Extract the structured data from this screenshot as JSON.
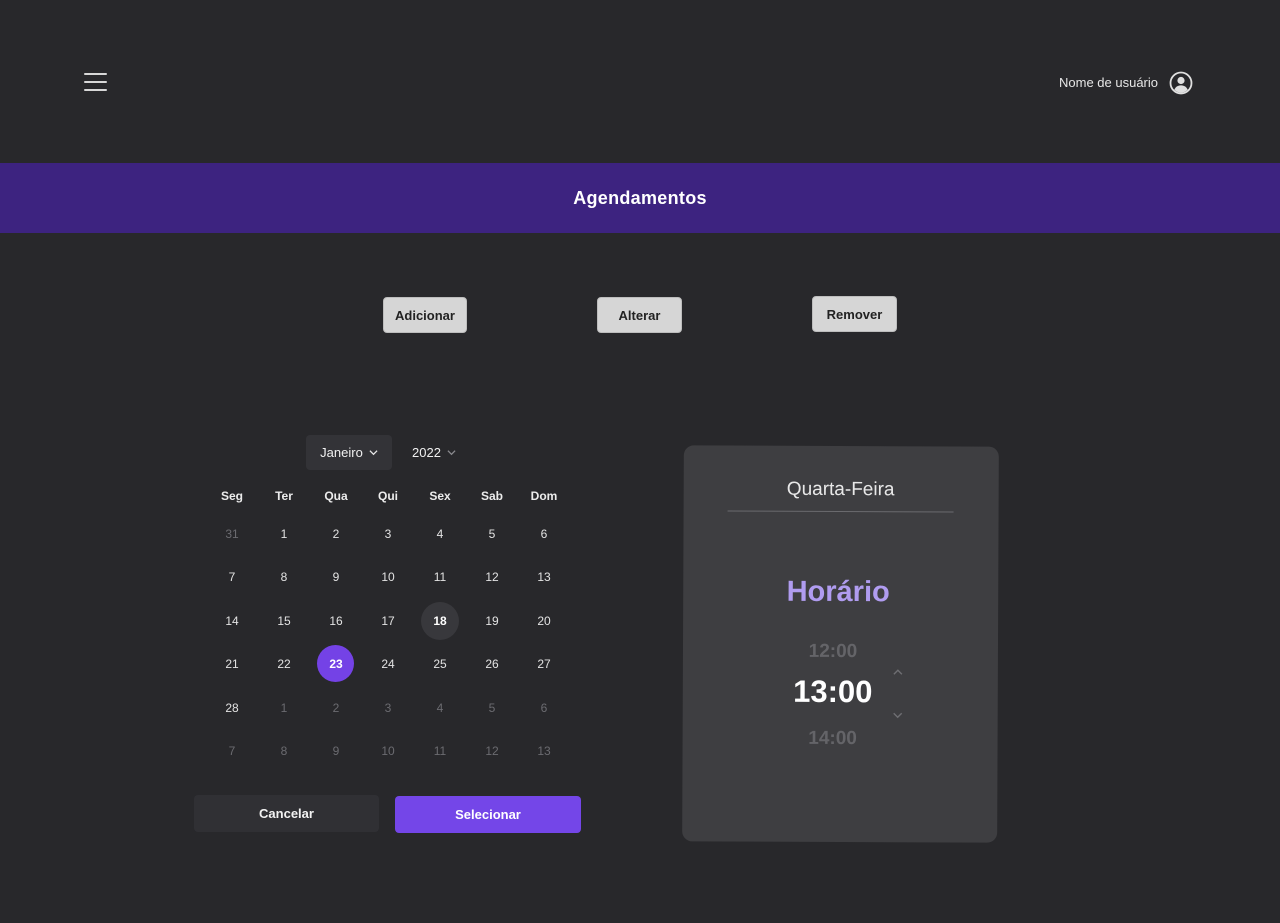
{
  "header": {
    "menu_icon": "hamburger-menu-icon",
    "user_name": "Nome de usuário",
    "user_icon": "user-circle-icon"
  },
  "title_bar": {
    "title": "Agendamentos",
    "background": "#3d2380"
  },
  "actions": {
    "add": "Adicionar",
    "edit": "Alterar",
    "remove": "Remover"
  },
  "calendar": {
    "month": "Janeiro",
    "year": "2022",
    "weekdays": [
      "Seg",
      "Ter",
      "Qua",
      "Qui",
      "Sex",
      "Sab",
      "Dom"
    ],
    "weeks": [
      [
        {
          "d": "31",
          "m": true
        },
        {
          "d": "1"
        },
        {
          "d": "2"
        },
        {
          "d": "3"
        },
        {
          "d": "4"
        },
        {
          "d": "5"
        },
        {
          "d": "6"
        }
      ],
      [
        {
          "d": "7"
        },
        {
          "d": "8"
        },
        {
          "d": "9"
        },
        {
          "d": "10"
        },
        {
          "d": "11"
        },
        {
          "d": "12"
        },
        {
          "d": "13"
        }
      ],
      [
        {
          "d": "14"
        },
        {
          "d": "15"
        },
        {
          "d": "16"
        },
        {
          "d": "17"
        },
        {
          "d": "18",
          "today": true
        },
        {
          "d": "19"
        },
        {
          "d": "20"
        }
      ],
      [
        {
          "d": "21"
        },
        {
          "d": "22"
        },
        {
          "d": "23",
          "selected": true
        },
        {
          "d": "24"
        },
        {
          "d": "25"
        },
        {
          "d": "26"
        },
        {
          "d": "27"
        }
      ],
      [
        {
          "d": "28"
        },
        {
          "d": "1",
          "m": true
        },
        {
          "d": "2",
          "m": true
        },
        {
          "d": "3",
          "m": true
        },
        {
          "d": "4",
          "m": true
        },
        {
          "d": "5",
          "m": true
        },
        {
          "d": "6",
          "m": true
        }
      ],
      [
        {
          "d": "7",
          "m": true
        },
        {
          "d": "8",
          "m": true
        },
        {
          "d": "9",
          "m": true
        },
        {
          "d": "10",
          "m": true
        },
        {
          "d": "11",
          "m": true
        },
        {
          "d": "12",
          "m": true
        },
        {
          "d": "13",
          "m": true
        }
      ]
    ],
    "cancel_label": "Cancelar",
    "select_label": "Selecionar",
    "accent": "#7446e8"
  },
  "time_picker": {
    "day_name": "Quarta-Feira",
    "title": "Horário",
    "previous": "12:00",
    "current": "13:00",
    "next": "14:00",
    "accent": "#b09cf0"
  }
}
